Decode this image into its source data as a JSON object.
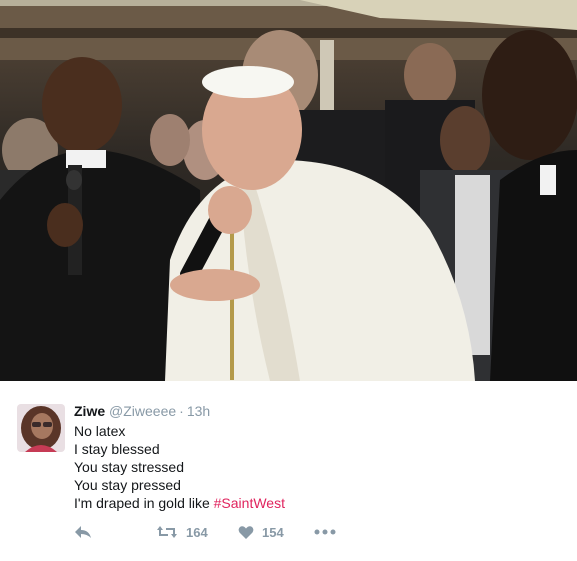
{
  "photo": {
    "description_icon": "photo-icon"
  },
  "tweet": {
    "display_name": "Ziwe",
    "handle": "@Ziweeee",
    "separator": "·",
    "timestamp": "13h",
    "lines": [
      "No latex",
      "I stay blessed",
      "You stay stressed",
      "You stay pressed"
    ],
    "last_line_prefix": "I'm draped in gold like ",
    "hashtag": "#SaintWest",
    "retweet_count": "164",
    "like_count": "154"
  },
  "colors": {
    "hashtag": "#e0245e",
    "meta": "#8899a6",
    "text": "#14171a"
  }
}
